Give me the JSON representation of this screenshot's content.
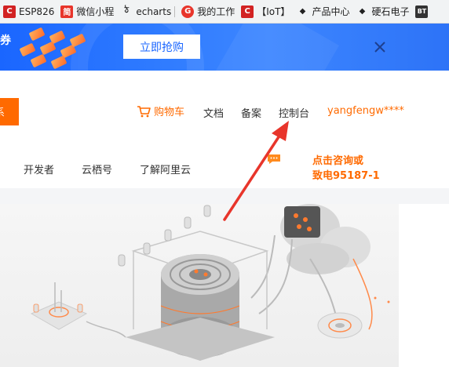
{
  "bookmarks": [
    {
      "label": "ESP826",
      "icon": "c-logo-icon",
      "icon_text": "C"
    },
    {
      "label": "微信小程",
      "icon": "jian-icon",
      "icon_text": "简"
    },
    {
      "label": "echarts",
      "icon": "echarts-logo-icon",
      "icon_text": "ঠ"
    },
    {
      "label": "我的工作",
      "icon": "gitee-icon",
      "icon_text": "G"
    },
    {
      "label": "【IoT】",
      "icon": "c-logo-icon",
      "icon_text": "C"
    },
    {
      "label": "产品中心",
      "icon": "cube-icon",
      "icon_text": "◆"
    },
    {
      "label": "硬石电子",
      "icon": "cube-icon",
      "icon_text": "◆"
    },
    {
      "label": "",
      "icon": "bt-icon",
      "icon_text": "BT"
    }
  ],
  "promo": {
    "text_fragment": "券",
    "button_label": "立即抢购"
  },
  "header": {
    "orange_button_fragment": "系",
    "cart_label": "购物车",
    "links": [
      "文档",
      "备案",
      "控制台"
    ],
    "username": "yangfengw****"
  },
  "secondary_nav": [
    "开发者",
    "云栖号",
    "了解阿里云"
  ],
  "consult": {
    "line1": "点击咨询或",
    "line2": "致电95187-1"
  },
  "colors": {
    "accent": "#ff6a00",
    "promo_bg": "#1a66ff",
    "arrow": "#e8352b"
  }
}
